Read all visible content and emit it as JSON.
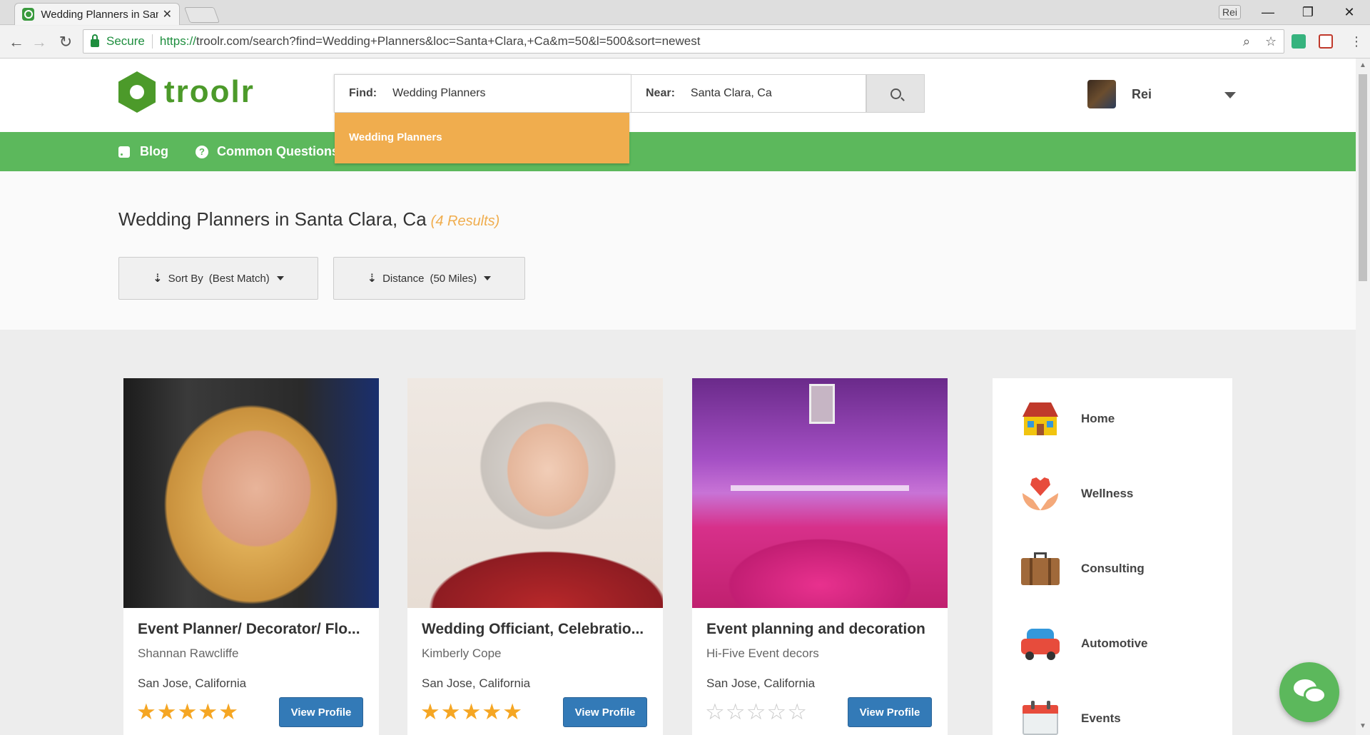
{
  "browser": {
    "tab_title": "Wedding Planners in Santa",
    "tab_close": "✕",
    "profile_name": "Rei",
    "secure_label": "Secure",
    "url_proto": "https://",
    "url_rest": "troolr.com/search?find=Wedding+Planners&loc=Santa+Clara,+Ca&m=50&l=500&sort=newest"
  },
  "site": {
    "logo_text": "troolr",
    "brand_green": "#5cb85c",
    "accent_orange": "#f0ad4e",
    "button_blue": "#337ab7"
  },
  "search": {
    "find_label": "Find:",
    "find_value": "Wedding Planners",
    "near_label": "Near:",
    "near_value": "Santa Clara, Ca",
    "suggestion": "Wedding Planners"
  },
  "user": {
    "name": "Rei"
  },
  "nav": {
    "items": [
      {
        "label": "Blog",
        "icon": "rss-icon"
      },
      {
        "label": "Common Questions",
        "icon": "question-icon"
      }
    ]
  },
  "results": {
    "title": "Wedding Planners in Santa Clara, Ca",
    "count": "(4 Results)",
    "sort_label": "Sort By",
    "sort_value": "(Best Match)",
    "distance_label": "Distance",
    "distance_value": "(50 Miles)"
  },
  "cards": [
    {
      "title": "Event Planner/ Decorator/ Flo...",
      "subtitle": "Shannan Rawcliffe",
      "location": "San Jose, California",
      "rating": 5,
      "button": "View Profile"
    },
    {
      "title": "Wedding Officiant, Celebratio...",
      "subtitle": "Kimberly Cope",
      "location": "San Jose, California",
      "rating": 5,
      "button": "View Profile"
    },
    {
      "title": "Event planning and decoration",
      "subtitle": "Hi-Five Event decors",
      "location": "San Jose, California",
      "rating": 0,
      "button": "View Profile"
    }
  ],
  "categories": [
    {
      "label": "Home",
      "icon": "house-icon"
    },
    {
      "label": "Wellness",
      "icon": "heart-hands-icon"
    },
    {
      "label": "Consulting",
      "icon": "briefcase-icon"
    },
    {
      "label": "Automotive",
      "icon": "car-icon"
    },
    {
      "label": "Events",
      "icon": "calendar-icon"
    }
  ]
}
